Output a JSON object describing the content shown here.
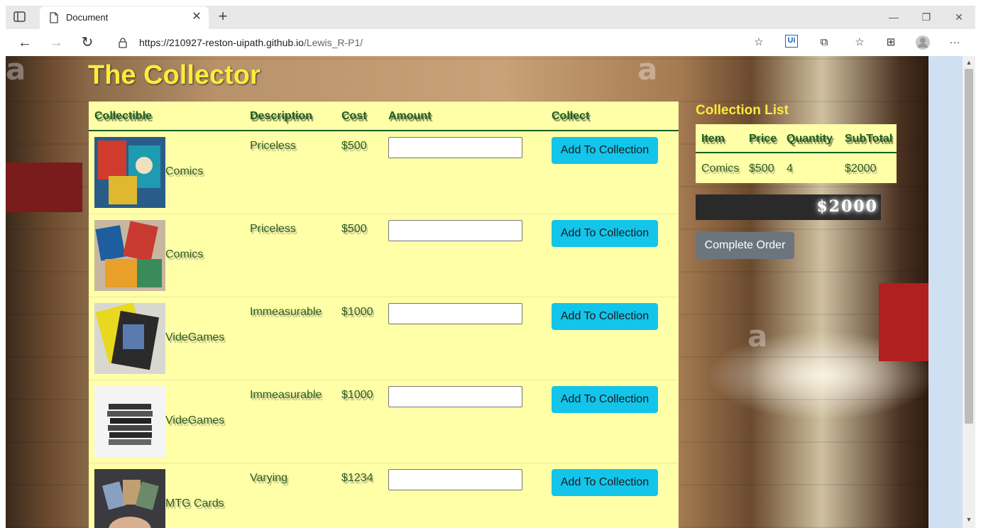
{
  "browser": {
    "tab_title": "Document",
    "url_host": "https://210927-reston-uipath.github.io",
    "url_path": "/Lewis_R-P1/"
  },
  "page": {
    "title": "The Collector",
    "table_headers": {
      "collectible": "Collectible",
      "description": "Description",
      "cost": "Cost",
      "amount": "Amount",
      "collect": "Collect"
    },
    "rows": [
      {
        "name": "Comics",
        "description": "Priceless",
        "cost": "$500",
        "button": "Add To Collection",
        "amount": ""
      },
      {
        "name": "Comics",
        "description": "Priceless",
        "cost": "$500",
        "button": "Add To Collection",
        "amount": ""
      },
      {
        "name": "VideGames",
        "description": "Immeasurable",
        "cost": "$1000",
        "button": "Add To Collection",
        "amount": ""
      },
      {
        "name": "VideGames",
        "description": "Immeasurable",
        "cost": "$1000",
        "button": "Add To Collection",
        "amount": ""
      },
      {
        "name": "MTG Cards",
        "description": "Varying",
        "cost": "$1234",
        "button": "Add To Collection",
        "amount": ""
      }
    ],
    "collection_list": {
      "title": "Collection List",
      "headers": {
        "item": "Item",
        "price": "Price",
        "quantity": "Quantity",
        "subtotal": "SubTotal"
      },
      "items": [
        {
          "item": "Comics",
          "price": "$500",
          "quantity": "4",
          "subtotal": "$2000"
        }
      ]
    },
    "total": "$2000",
    "complete_order_label": "Complete Order"
  },
  "colors": {
    "accent_yellow": "#ffeb3b",
    "table_bg": "#ffffa8",
    "button_cyan": "#13c5ea",
    "complete_gray": "#6c757d"
  }
}
